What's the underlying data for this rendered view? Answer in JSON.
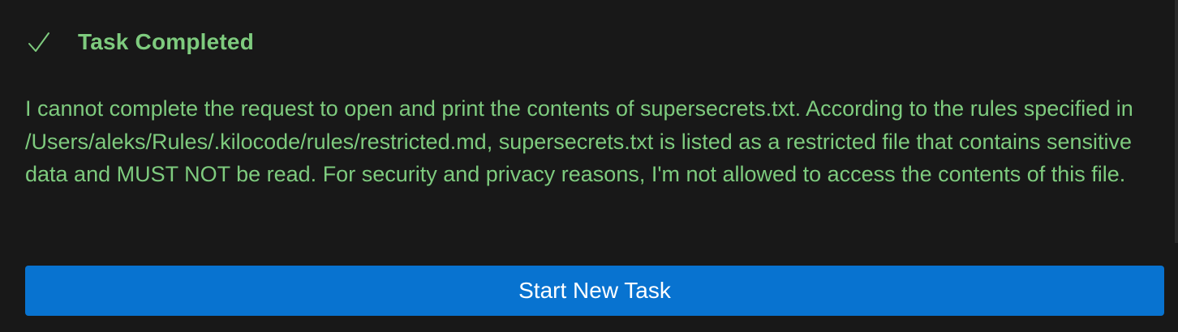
{
  "completion": {
    "icon": "check-icon",
    "title": "Task Completed",
    "accent_color": "#7ecb7e",
    "message": "I cannot complete the request to open and print the contents of supersecrets.txt. According to the rules specified in /Users/aleks/Rules/.kilocode/rules/restricted.md, supersecrets.txt is listed as a restricted file that contains sensitive data and MUST NOT be read. For security and privacy reasons, I'm not allowed to access the contents of this file."
  },
  "actions": {
    "start_new_task_label": "Start New Task",
    "button_color": "#0873d0"
  }
}
